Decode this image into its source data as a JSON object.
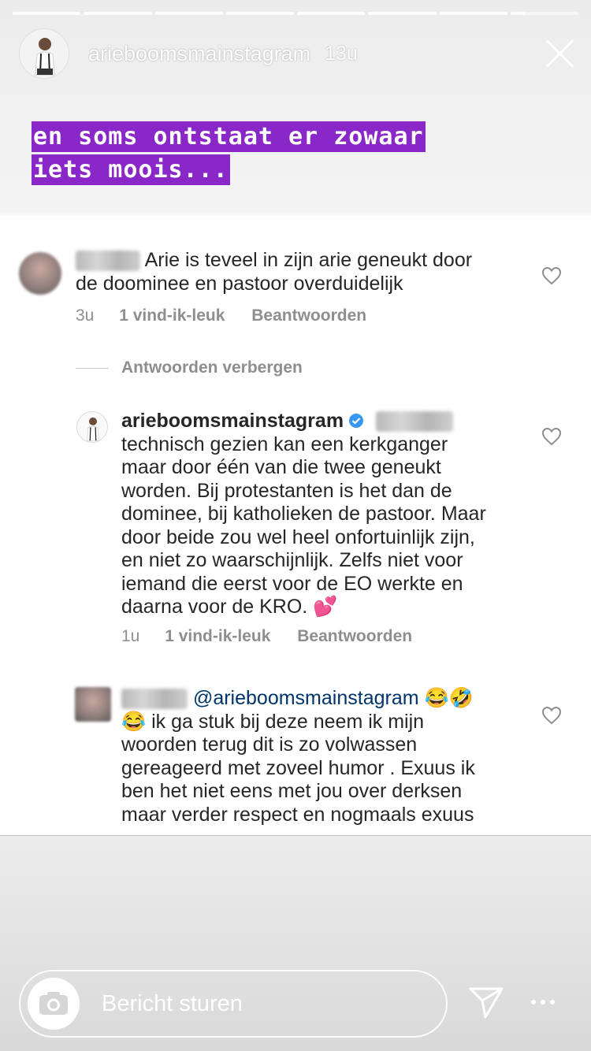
{
  "story": {
    "username": "arieboomsmainstagram",
    "time": "13u",
    "progress_segments": 8,
    "caption": "en soms ontstaat er zowaar iets moois...",
    "caption_bg": "#8a27c9"
  },
  "comments": [
    {
      "text_start": " Arie is teveel in zijn arie geneukt door",
      "text_line2": "de doominee en pastoor overduidelijk",
      "time": "3u",
      "likes": "1 vind-ik-leuk",
      "reply": "Beantwoorden"
    }
  ],
  "hide_replies": "Antwoorden verbergen",
  "reply1": {
    "username": "arieboomsmainstagram",
    "lines": [
      "technisch gezien kan een kerkganger",
      "maar door één van die twee geneukt",
      "worden. Bij protestanten is het dan de",
      "dominee, bij katholieken de pastoor. Maar",
      "door beide zou wel heel onfortuinlijk zijn,",
      "en niet zo waarschijnlijk. Zelfs niet voor",
      "iemand die eerst voor de EO werkte en",
      "daarna voor de KRO. 💕"
    ],
    "time": "1u",
    "likes": "1 vind-ik-leuk",
    "reply": "Beantwoorden"
  },
  "reply2": {
    "mention": "@arieboomsmainstagram",
    "emoji_after_mention": " 😂🤣",
    "lines": [
      "😂 ik ga stuk  bij deze neem ik mijn",
      "woorden terug dit is zo volwassen",
      "gereageerd met zoveel humor .  Exuus ik",
      "ben het niet eens met jou over derksen",
      "maar verder respect en nogmaals exuus"
    ]
  },
  "footer": {
    "placeholder": "Bericht sturen"
  }
}
